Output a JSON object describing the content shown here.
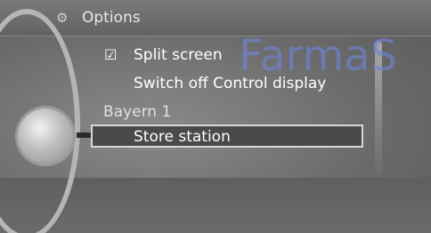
{
  "header": {
    "icon": "options-icon",
    "title": "Options"
  },
  "menu": {
    "items": [
      {
        "label": "Split screen",
        "icon": "checkbox-checked-icon"
      },
      {
        "label": "Switch off Control display"
      }
    ],
    "section_label": "Bayern 1",
    "selected_item": {
      "label": "Store station"
    }
  },
  "watermark": "FarmaS"
}
